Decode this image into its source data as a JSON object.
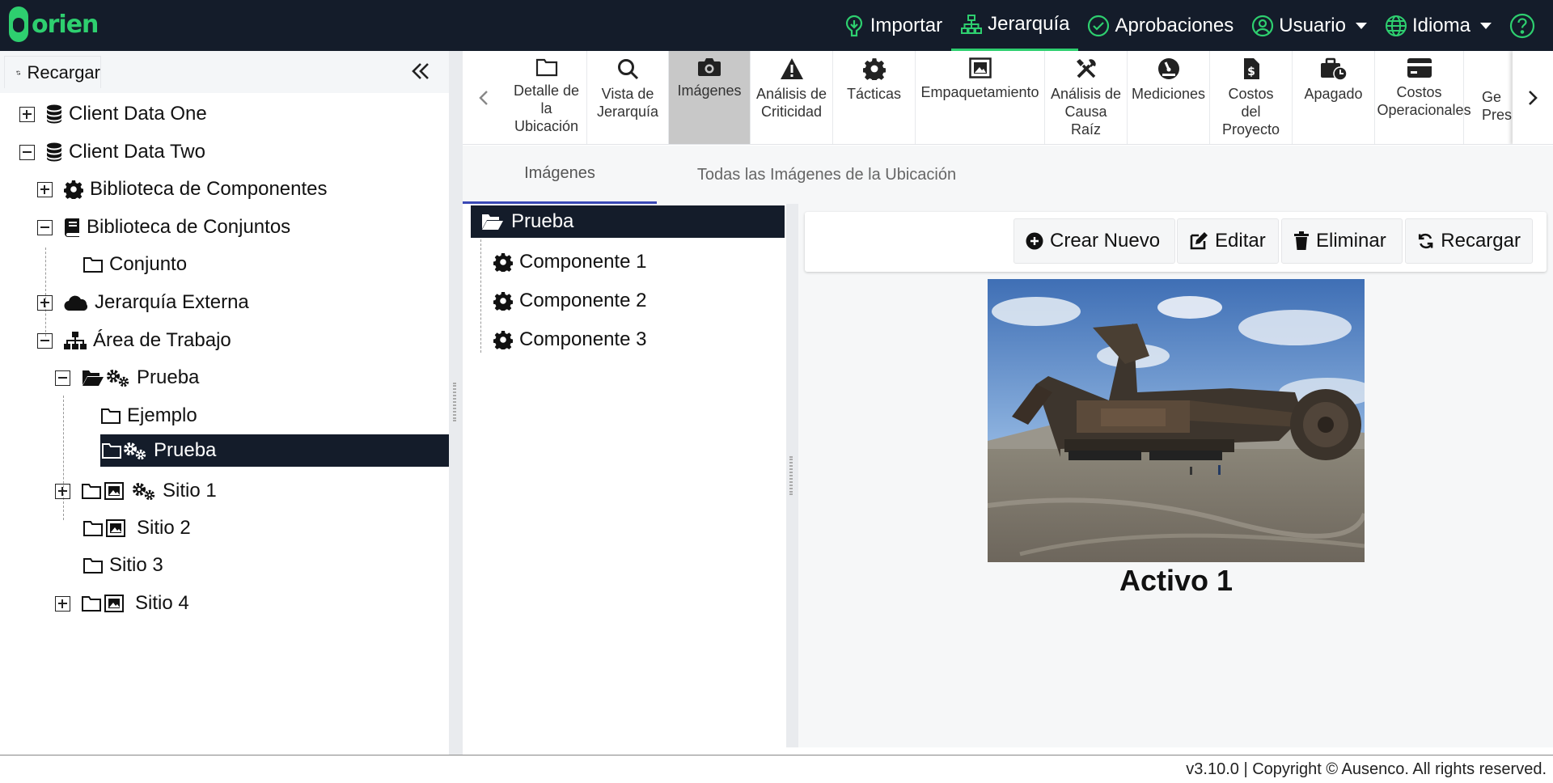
{
  "brand": {
    "logo_text": "orien",
    "accent": "#2ecf6f",
    "dark": "#141c2a"
  },
  "nav": [
    {
      "label": "Importar",
      "icon": "import-icon"
    },
    {
      "label": "Jerarquía",
      "icon": "hierarchy-icon",
      "active": true
    },
    {
      "label": "Aprobaciones",
      "icon": "check-circle-icon"
    },
    {
      "label": "Usuario",
      "icon": "user-icon",
      "dropdown": true
    },
    {
      "label": "Idioma",
      "icon": "globe-icon",
      "dropdown": true
    },
    {
      "label": "",
      "icon": "help-icon"
    }
  ],
  "left": {
    "reload_label": "Recargar",
    "tree": [
      {
        "label": "Client Data One"
      },
      {
        "label": "Client Data Two"
      },
      {
        "label": "Biblioteca de Componentes"
      },
      {
        "label": "Biblioteca de Conjuntos"
      },
      {
        "label": "Conjunto"
      },
      {
        "label": "Jerarquía Externa"
      },
      {
        "label": "Área de Trabajo"
      },
      {
        "label": "Prueba"
      },
      {
        "label": "Ejemplo"
      },
      {
        "label": "Prueba",
        "selected": true
      },
      {
        "label": "Sitio 1"
      },
      {
        "label": "Sitio 2"
      },
      {
        "label": "Sitio 3"
      },
      {
        "label": "Sitio 4"
      }
    ]
  },
  "tools": [
    {
      "label": "Detalle de la Ubicación"
    },
    {
      "label": "Vista de Jerarquía"
    },
    {
      "label": "Imágenes",
      "active": true
    },
    {
      "label": "Análisis de Criticidad"
    },
    {
      "label": "Tácticas"
    },
    {
      "label": "Empaquetamiento"
    },
    {
      "label": "Análisis de Causa Raíz"
    },
    {
      "label": "Mediciones"
    },
    {
      "label": "Costos del Proyecto"
    },
    {
      "label": "Apagado"
    },
    {
      "label": "Costos Operacionales"
    },
    {
      "label": "Ge Pres"
    }
  ],
  "sub_tabs": [
    "Imágenes",
    "Todas las Imágenes de la Ubicación"
  ],
  "image_tree": [
    {
      "label": "Prueba",
      "selected": true
    },
    {
      "label": "Componente 1"
    },
    {
      "label": "Componente 2"
    },
    {
      "label": "Componente 3"
    }
  ],
  "actions": {
    "create": "Crear Nuevo",
    "edit": "Editar",
    "delete": "Eliminar",
    "reload": "Recargar"
  },
  "image": {
    "caption": "Activo 1"
  },
  "footer": "v3.10.0 | Copyright © Ausenco. All rights reserved."
}
